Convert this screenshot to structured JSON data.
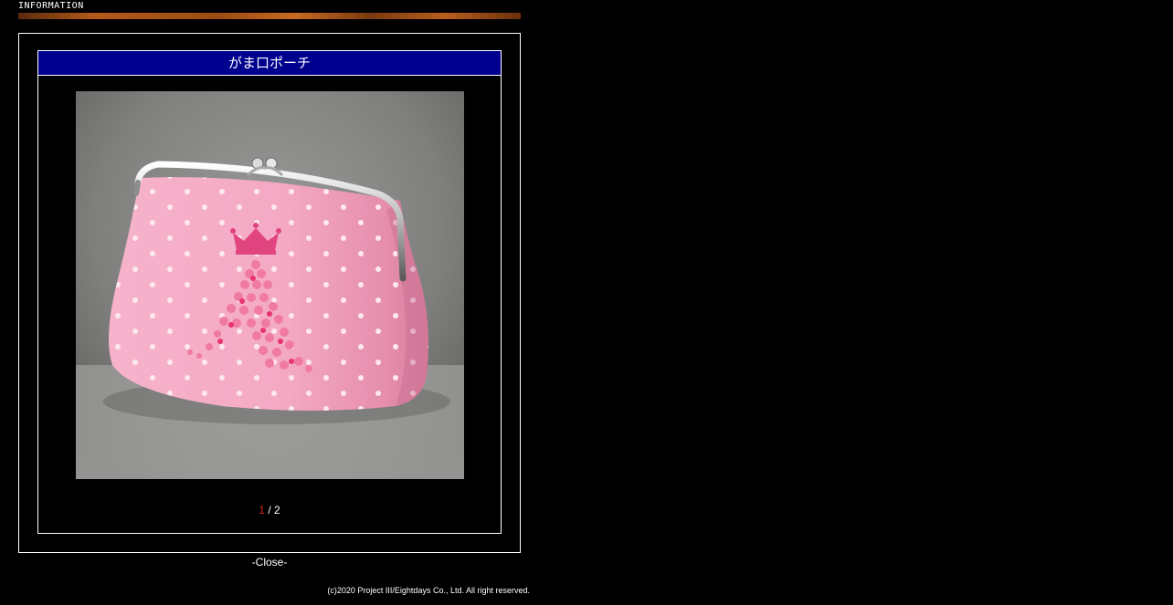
{
  "header": {
    "label": "INFORMATION"
  },
  "popup": {
    "title": "がま口ポーチ",
    "image_alt": "pink gamaguchi pouch with crown letter A",
    "pager": {
      "current": "1",
      "separator": " / ",
      "total": "2"
    }
  },
  "footer": {
    "close_label": "-Close-",
    "copyright": "(c)2020 Project III/Eightdays Co., Ltd. All right reserved."
  },
  "colors": {
    "title_bar": "#00008f",
    "current_page": "#d9261c",
    "header_bar": "#b35a18",
    "pouch_pink": "#f4a6c4"
  }
}
